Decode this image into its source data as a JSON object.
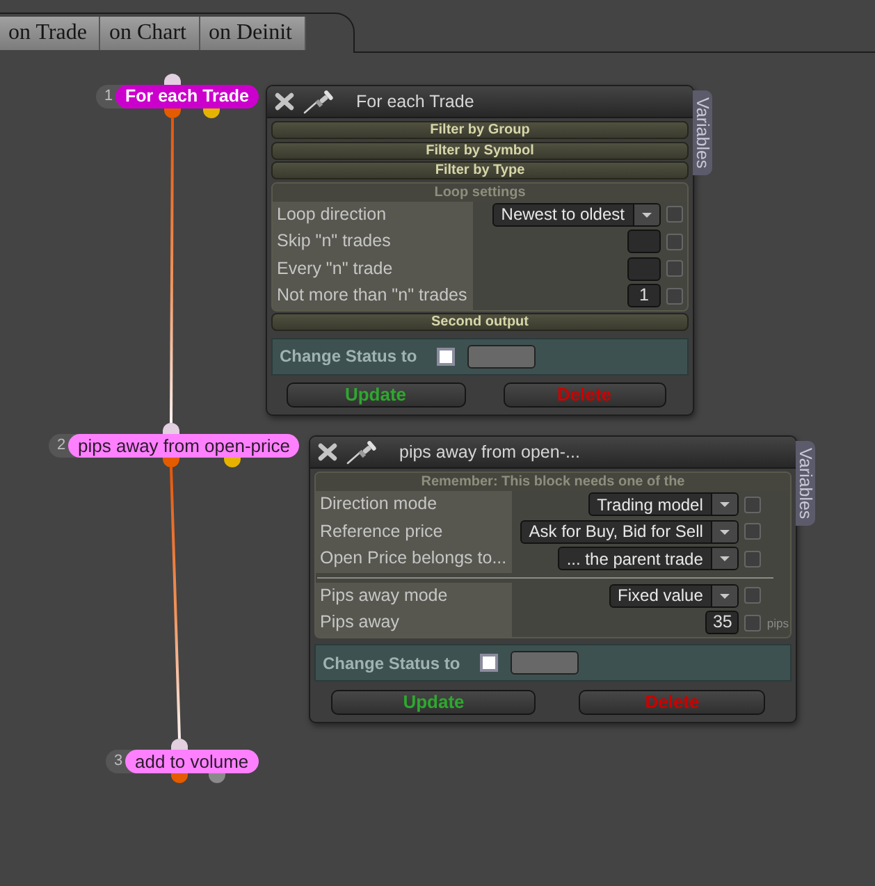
{
  "tabs": [
    {
      "label": "on Trade"
    },
    {
      "label": "on Chart"
    },
    {
      "label": "on Deinit"
    }
  ],
  "nodes": [
    {
      "number": "1",
      "label": "For each Trade",
      "color": "#cc00cc",
      "outputs": [
        {
          "color": "#e55b00"
        },
        {
          "color": "#e6b400"
        }
      ]
    },
    {
      "number": "2",
      "label": "pips away from open-price",
      "color": "#ff80ff",
      "outputs": [
        {
          "color": "#e55b00"
        },
        {
          "color": "#e6b400"
        }
      ]
    },
    {
      "number": "3",
      "label": "add to volume",
      "color": "#ff80ff",
      "outputs": [
        {
          "color": "#e55b00"
        },
        {
          "color": "#8a8a8a"
        }
      ]
    }
  ],
  "panels": [
    {
      "title": "For each Trade",
      "side_tab": "Variables",
      "sections": [
        {
          "title": "Filter by Group",
          "expanded": false
        },
        {
          "title": "Filter by Symbol",
          "expanded": false
        },
        {
          "title": "Filter by Type",
          "expanded": false
        },
        {
          "title": "Loop settings",
          "expanded": true,
          "rows": [
            {
              "kind": "dropdown",
              "label": "Loop direction",
              "value": "Newest to oldest",
              "checked": false
            },
            {
              "kind": "number",
              "label": "Skip \"n\" trades",
              "checked": false
            },
            {
              "kind": "number",
              "label": "Every \"n\" trade",
              "checked": false
            },
            {
              "kind": "number",
              "label": "Not more than \"n\" trades",
              "value": "1",
              "checked": false
            }
          ]
        },
        {
          "title": "Second output",
          "expanded": false
        }
      ],
      "change_status": {
        "label": "Change Status to",
        "checked": false
      },
      "buttons": [
        {
          "kind": "update",
          "label": "Update"
        },
        {
          "kind": "delete",
          "label": "Delete"
        }
      ]
    },
    {
      "title": "pips away from open-...",
      "side_tab": "Variables",
      "sections": [
        {
          "title": "Remember: This block needs one of the",
          "expanded": true,
          "rows": [
            {
              "kind": "dropdown",
              "label": "Direction mode",
              "value": "Trading model",
              "checked": false
            },
            {
              "kind": "dropdown",
              "label": "Reference price",
              "value": "Ask for Buy, Bid for Sell",
              "checked": false
            },
            {
              "kind": "dropdown",
              "label": "Open Price belongs to...",
              "value": "... the parent trade",
              "checked": false
            },
            {
              "kind": "divider"
            },
            {
              "kind": "dropdown",
              "label": "Pips away mode",
              "value": "Fixed value",
              "checked": false
            },
            {
              "kind": "number",
              "label": "Pips away",
              "value": "35",
              "checked": false,
              "unit": "pips"
            }
          ]
        }
      ],
      "change_status": {
        "label": "Change Status to",
        "checked": false
      },
      "buttons": [
        {
          "kind": "update",
          "label": "Update"
        },
        {
          "kind": "delete",
          "label": "Delete"
        }
      ]
    }
  ]
}
